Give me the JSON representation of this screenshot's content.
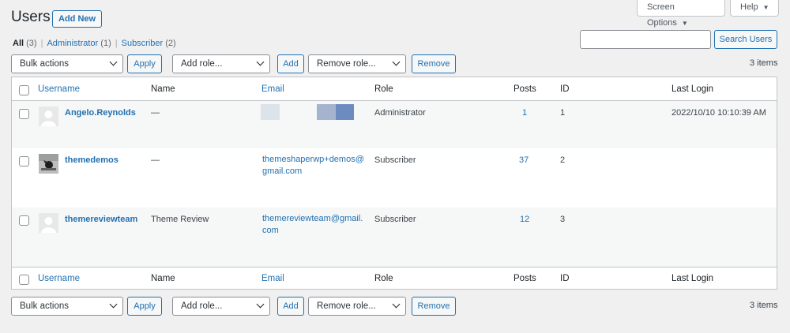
{
  "header": {
    "title": "Users",
    "add_new": "Add New",
    "screen_options": "Screen Options",
    "help": "Help"
  },
  "filters": {
    "all": "All",
    "all_count": "(3)",
    "administrator": "Administrator",
    "administrator_count": "(1)",
    "subscriber": "Subscriber",
    "subscriber_count": "(2)"
  },
  "search": {
    "button": "Search Users",
    "value": ""
  },
  "toolbar": {
    "bulk_actions": "Bulk actions",
    "apply": "Apply",
    "add_role": "Add role...",
    "add": "Add",
    "remove_role": "Remove role...",
    "remove": "Remove",
    "items": "3 items"
  },
  "columns": {
    "username": "Username",
    "name": "Name",
    "email": "Email",
    "role": "Role",
    "posts": "Posts",
    "id": "ID",
    "last_login": "Last Login"
  },
  "users": [
    {
      "username": "Angelo.Reynolds",
      "name": "—",
      "email_line1": "",
      "email_line2": "",
      "role": "Administrator",
      "posts": "1",
      "id": "1",
      "last_login": "2022/10/10 10:10:39 AM"
    },
    {
      "username": "themedemos",
      "name": "—",
      "email_line1": "themeshaperwp+demos@",
      "email_line2": "gmail.com",
      "role": "Subscriber",
      "posts": "37",
      "id": "2",
      "last_login": ""
    },
    {
      "username": "themereviewteam",
      "name": "Theme Review",
      "email_line1": "themereviewteam@gmail.",
      "email_line2": "com",
      "role": "Subscriber",
      "posts": "12",
      "id": "3",
      "last_login": ""
    }
  ],
  "colors": {
    "accent": "#2271b1",
    "background": "#f0f0f1",
    "redaction_light": "#dde3eb",
    "redaction_mid": "#a5b3cf",
    "redaction_dark": "#6c8bbf"
  }
}
